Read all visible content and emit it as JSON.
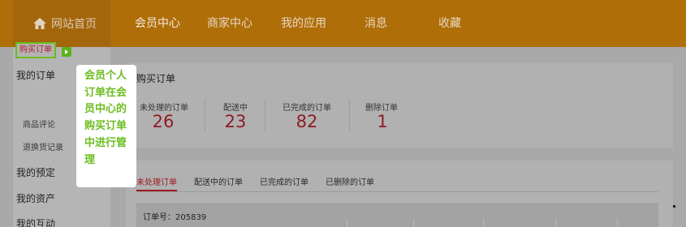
{
  "topnav": {
    "home": "网站首页",
    "items": [
      "会员中心",
      "商家中心",
      "我的应用",
      "消息",
      "收藏"
    ]
  },
  "sidebar": {
    "my_orders": "我的订单",
    "purchase_orders": "购买订单",
    "product_reviews": "商品评论",
    "returns": "退换货记录",
    "my_bookings": "我的预定",
    "my_assets": "我的资产",
    "my_interactions": "我的互动"
  },
  "callout": {
    "text": "会员个人订单在会员中心的购买订单中进行管理"
  },
  "main": {
    "title": "购买订单",
    "stats": [
      {
        "label": "未处理的订单",
        "value": "26"
      },
      {
        "label": "配送中",
        "value": "23"
      },
      {
        "label": "已完成的订单",
        "value": "82"
      },
      {
        "label": "删除订单",
        "value": "1"
      }
    ],
    "tabs": [
      "未处理订单",
      "配送中的订单",
      "已完成的订单",
      "已删除的订单"
    ],
    "order_number": "订单号：205839"
  },
  "colors": {
    "topbar": "#b06e08",
    "accent_green": "#6cbd20",
    "accent_red": "#9c1c22"
  },
  "icons": {
    "home": "home-icon",
    "active_arrow": "arrow-right-icon"
  }
}
